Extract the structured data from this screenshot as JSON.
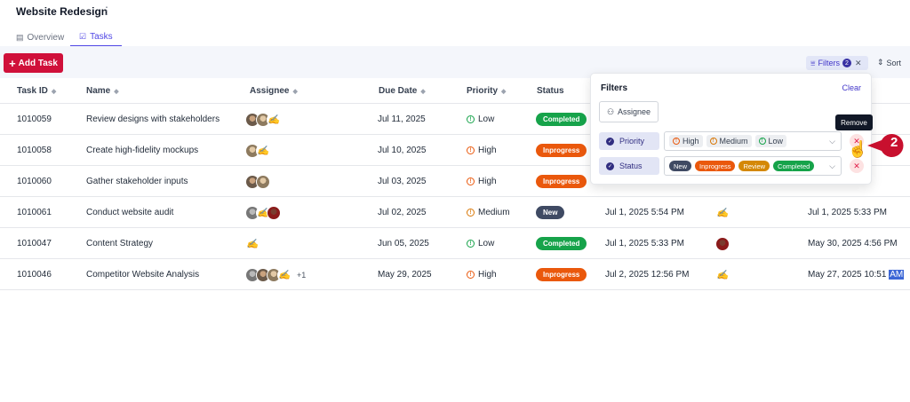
{
  "project": {
    "title": "Website Redesign",
    "menu_icon": "more-vertical-icon"
  },
  "tabs": [
    {
      "label": "Overview",
      "icon": "clipboard-icon"
    },
    {
      "label": "Tasks",
      "icon": "checkbox-icon",
      "active": true
    }
  ],
  "toolbar": {
    "add_label": "Add Task",
    "filters_label": "Filters",
    "filters_count": "2",
    "sort_label": "Sort"
  },
  "table": {
    "columns": [
      "Task ID",
      "Name",
      "Assignee",
      "Due Date",
      "Priority",
      "Status"
    ],
    "rows": [
      {
        "id": "1010059",
        "name": "Review designs with stakeholders",
        "due": "Jul 11, 2025",
        "priority": "Low",
        "status": "Completed",
        "created": "",
        "updated": ""
      },
      {
        "id": "1010058",
        "name": "Create high-fidelity mockups",
        "due": "Jul 10, 2025",
        "priority": "High",
        "status": "Inprogress",
        "created": "",
        "updated": ""
      },
      {
        "id": "1010060",
        "name": "Gather stakeholder inputs",
        "due": "Jul 03, 2025",
        "priority": "High",
        "status": "Inprogress",
        "created": "",
        "updated": ""
      },
      {
        "id": "1010061",
        "name": "Conduct website audit",
        "due": "Jul 02, 2025",
        "priority": "Medium",
        "status": "New",
        "created": "Jul 1, 2025 5:54 PM",
        "updated": "Jul 1, 2025 5:33 PM"
      },
      {
        "id": "1010047",
        "name": "Content Strategy",
        "due": "Jun 05, 2025",
        "priority": "Low",
        "status": "Completed",
        "created": "Jul 1, 2025 5:33 PM",
        "updated": "May 30, 2025 4:56 PM"
      },
      {
        "id": "1010046",
        "name": "Competitor Website Analysis",
        "due": "May 29, 2025",
        "priority": "High",
        "status": "Inprogress",
        "created": "Jul 2, 2025 12:56 PM",
        "updated_main": "May 27, 2025 10:51 ",
        "updated_sel": "AM",
        "extra_assignees": "+1"
      }
    ]
  },
  "filters_panel": {
    "title": "Filters",
    "clear_label": "Clear",
    "assignee_label": "Assignee",
    "priority_label": "Priority",
    "priority_values": [
      "High",
      "Medium",
      "Low"
    ],
    "status_label": "Status",
    "status_values": [
      "New",
      "Inprogress",
      "Review",
      "Completed"
    ]
  },
  "tooltip": "Remove",
  "callout_number": "2",
  "colors": {
    "accent": "#4f46e5",
    "add_button": "#d0103a",
    "completed": "#16a34a",
    "inprogress": "#ea580c",
    "new": "#3f4a63",
    "review": "#d48806"
  }
}
